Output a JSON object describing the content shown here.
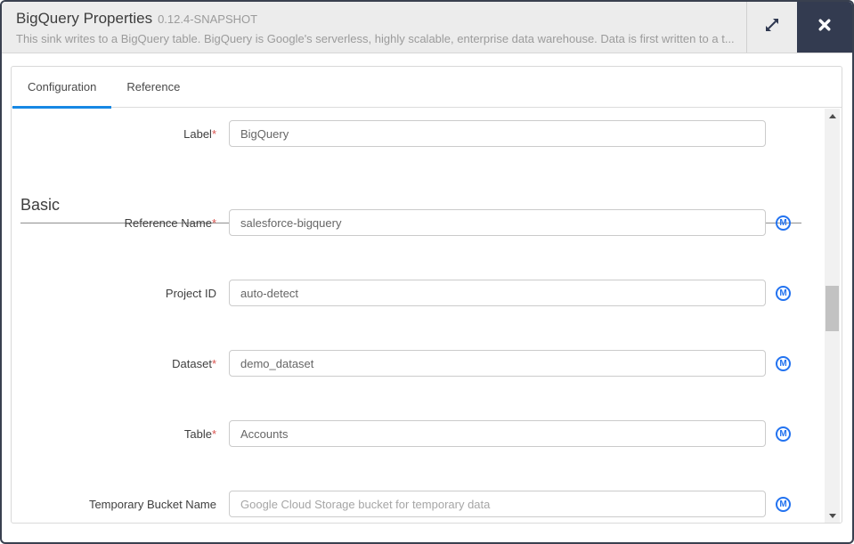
{
  "header": {
    "title": "BigQuery Properties",
    "version": "0.12.4-SNAPSHOT",
    "description": "This sink writes to a BigQuery table. BigQuery is Google's serverless, highly scalable, enterprise data warehouse. Data is first written to a t...",
    "expand_icon": "diagonal-resize-arrows",
    "close_icon": "x"
  },
  "colors": {
    "header_bg": "#ececec",
    "close_button_bg": "#333b50",
    "tab_active_underline": "#1788e4",
    "macro_icon_blue": "#2373f0",
    "required_asterisk": "#d9534f"
  },
  "tabs": [
    {
      "label": "Configuration",
      "active": true
    },
    {
      "label": "Reference",
      "active": false
    }
  ],
  "form": {
    "section_heading": "Basic",
    "macro_letter": "M",
    "fields": [
      {
        "label": "Label",
        "required_mark": "*",
        "value": "BigQuery"
      },
      {
        "label": "Reference Name",
        "required_mark": "*",
        "value": "salesforce-bigquery"
      },
      {
        "label": "Project ID",
        "value": "auto-detect"
      },
      {
        "label": "Dataset",
        "required_mark": "*",
        "value": "demo_dataset"
      },
      {
        "label": "Table",
        "required_mark": "*",
        "value": "Accounts"
      },
      {
        "label": "Temporary Bucket Name",
        "value": "",
        "placeholder": "Google Cloud Storage bucket for temporary data"
      }
    ]
  }
}
